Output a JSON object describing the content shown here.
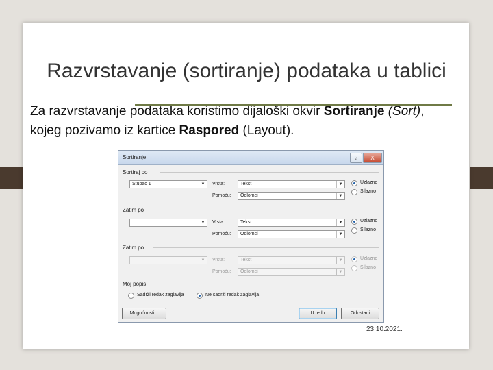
{
  "slide": {
    "title": "Razvrstavanje (sortiranje) podataka u tablici",
    "body": {
      "part1": "Za razvrstavanje podataka koristimo dijaloški okvir ",
      "bold1": "Sortiranje",
      "italic1": " (Sort)",
      "part2": ", kojeg pozivamo iz kartice ",
      "bold2": "Raspored",
      "part3": " (Layout)."
    },
    "date": "23.10.2021."
  },
  "dialog": {
    "title": "Sortiranje",
    "help_label": "?",
    "close_label": "X",
    "section1": {
      "label": "Sortiraj po",
      "column": "Stupac 1",
      "type_label": "Vrsta:",
      "type_value": "Tekst",
      "using_label": "Pomoću:",
      "using_value": "Odlomci",
      "asc": "Uzlazno",
      "desc": "Silazno"
    },
    "section2": {
      "label": "Zatim po",
      "column": "",
      "type_label": "Vrsta:",
      "type_value": "Tekst",
      "using_label": "Pomoću:",
      "using_value": "Odlomci",
      "asc": "Uzlazno",
      "desc": "Silazno"
    },
    "section3": {
      "label": "Zatim po",
      "column": "",
      "type_label": "Vrsta:",
      "type_value": "Tekst",
      "using_label": "Pomoću:",
      "using_value": "Odlomci",
      "asc": "Uzlazno",
      "desc": "Silazno"
    },
    "list": {
      "label": "Moj popis",
      "with_header": "Sadrži redak zaglavlja",
      "no_header": "Ne sadrži redak zaglavlja"
    },
    "buttons": {
      "options": "Mogućnosti...",
      "ok": "U redu",
      "cancel": "Odustani"
    }
  }
}
